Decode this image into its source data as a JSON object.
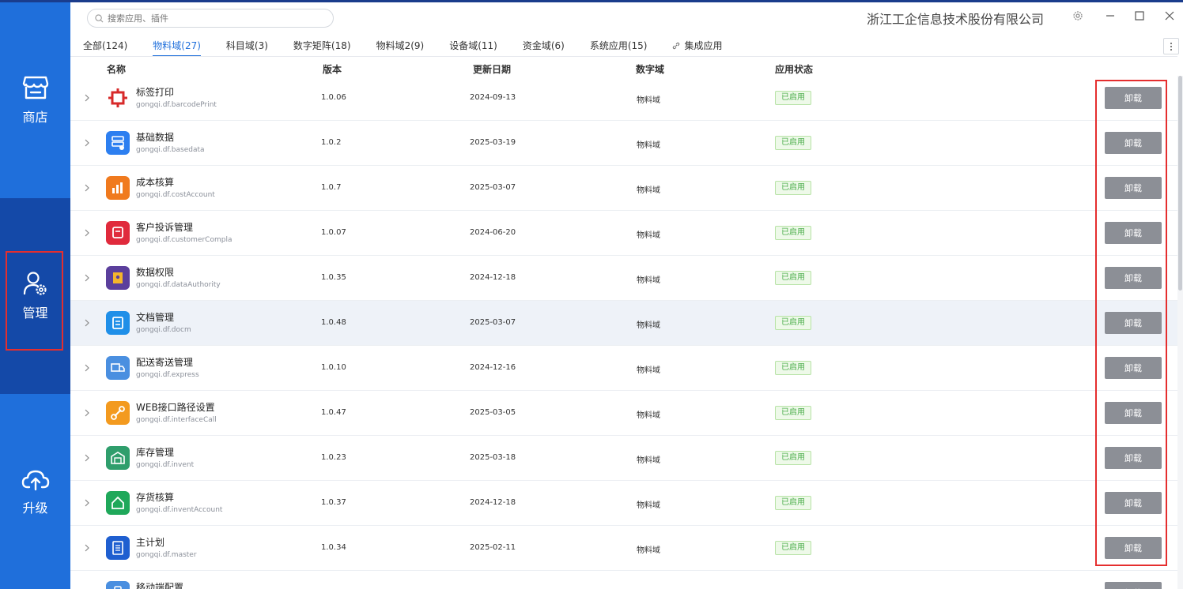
{
  "search": {
    "placeholder": "搜索应用、插件"
  },
  "company": "浙江工企信息技术股份有限公司",
  "sidebar": {
    "items": [
      {
        "label": "商店"
      },
      {
        "label": "管理"
      },
      {
        "label": "升级"
      }
    ]
  },
  "tabs": [
    {
      "label": "全部(124)"
    },
    {
      "label": "物料域(27)"
    },
    {
      "label": "科目域(3)"
    },
    {
      "label": "数字矩阵(18)"
    },
    {
      "label": "物料域2(9)"
    },
    {
      "label": "设备域(11)"
    },
    {
      "label": "资金域(6)"
    },
    {
      "label": "系统应用(15)"
    },
    {
      "label": "集成应用"
    }
  ],
  "active_tab": "物料域(27)",
  "table": {
    "headers": {
      "name": "名称",
      "version": "版本",
      "date": "更新日期",
      "domain": "数字域",
      "status": "应用状态"
    },
    "rows": [
      {
        "name": "标签打印",
        "pkg": "gongqi.df.barcodePrint",
        "version": "1.0.06",
        "date": "2024-09-13",
        "domain": "物料域",
        "status": "已启用",
        "action": "卸载",
        "icon": "barcode-print-icon",
        "color": "#d72a2a"
      },
      {
        "name": "基础数据",
        "pkg": "gongqi.df.basedata",
        "version": "1.0.2",
        "date": "2025-03-19",
        "domain": "物料域",
        "status": "已启用",
        "action": "卸载",
        "icon": "database-icon",
        "color": "#2d7ff0"
      },
      {
        "name": "成本核算",
        "pkg": "gongqi.df.costAccount",
        "version": "1.0.7",
        "date": "2025-03-07",
        "domain": "物料域",
        "status": "已启用",
        "action": "卸载",
        "icon": "cost-chart-icon",
        "color": "#f07a1e"
      },
      {
        "name": "客户投诉管理",
        "pkg": "gongqi.df.customerCompla",
        "version": "1.0.07",
        "date": "2024-06-20",
        "domain": "物料域",
        "status": "已启用",
        "action": "卸载",
        "icon": "complaint-icon",
        "color": "#e02a3c"
      },
      {
        "name": "数据权限",
        "pkg": "gongqi.df.dataAuthority",
        "version": "1.0.35",
        "date": "2024-12-18",
        "domain": "物料域",
        "status": "已启用",
        "action": "卸载",
        "icon": "data-authority-icon",
        "color": "#5b3f9c"
      },
      {
        "name": "文档管理",
        "pkg": "gongqi.df.docm",
        "version": "1.0.48",
        "date": "2025-03-07",
        "domain": "物料域",
        "status": "已启用",
        "action": "卸载",
        "icon": "document-icon",
        "color": "#1f8fe8"
      },
      {
        "name": "配送寄送管理",
        "pkg": "gongqi.df.express",
        "version": "1.0.10",
        "date": "2024-12-16",
        "domain": "物料域",
        "status": "已启用",
        "action": "卸载",
        "icon": "express-icon",
        "color": "#4a8fe0"
      },
      {
        "name": "WEB接口路径设置",
        "pkg": "gongqi.df.interfaceCall",
        "version": "1.0.47",
        "date": "2025-03-05",
        "domain": "物料域",
        "status": "已启用",
        "action": "卸载",
        "icon": "link-icon",
        "color": "#f39a1f"
      },
      {
        "name": "库存管理",
        "pkg": "gongqi.df.invent",
        "version": "1.0.23",
        "date": "2025-03-18",
        "domain": "物料域",
        "status": "已启用",
        "action": "卸载",
        "icon": "warehouse-icon",
        "color": "#2f9e6c"
      },
      {
        "name": "存货核算",
        "pkg": "gongqi.df.inventAccount",
        "version": "1.0.37",
        "date": "2024-12-18",
        "domain": "物料域",
        "status": "已启用",
        "action": "卸载",
        "icon": "inventory-account-icon",
        "color": "#1fa85a"
      },
      {
        "name": "主计划",
        "pkg": "gongqi.df.master",
        "version": "1.0.34",
        "date": "2025-02-11",
        "domain": "物料域",
        "status": "已启用",
        "action": "卸载",
        "icon": "master-plan-icon",
        "color": "#1f5fd0"
      },
      {
        "name": "移动端配置",
        "pkg": "",
        "version": "",
        "date": "",
        "domain": "",
        "status": "",
        "action": "卸载",
        "icon": "mobile-config-icon",
        "color": "#4a8fe0"
      }
    ]
  }
}
